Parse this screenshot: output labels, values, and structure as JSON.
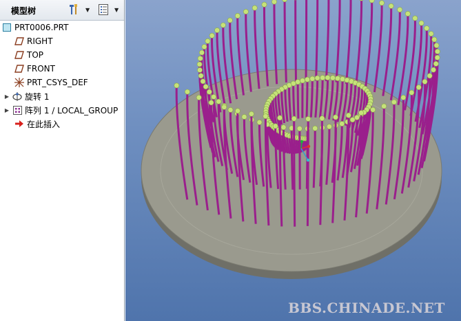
{
  "sidebar": {
    "title": "模型树",
    "tools": [
      {
        "icon": "model-tree-tools-icon"
      },
      {
        "icon": "tree-settings-icon"
      }
    ],
    "items": [
      {
        "label": "PRT0006.PRT",
        "icon": "part-icon",
        "expandable": false
      },
      {
        "label": "RIGHT",
        "icon": "datum-plane-icon",
        "expandable": false
      },
      {
        "label": "TOP",
        "icon": "datum-plane-icon",
        "expandable": false
      },
      {
        "label": "FRONT",
        "icon": "datum-plane-icon",
        "expandable": false
      },
      {
        "label": "PRT_CSYS_DEF",
        "icon": "coordinate-system-icon",
        "expandable": false
      },
      {
        "label": "旋转 1",
        "icon": "revolve-icon",
        "expandable": true
      },
      {
        "label": "阵列 1 / LOCAL_GROUP",
        "icon": "pattern-icon",
        "expandable": true
      },
      {
        "label": "在此插入",
        "icon": "insert-here-arrow-icon",
        "expandable": false
      }
    ]
  },
  "viewport": {
    "watermark": "BBS.CHINADE.NET",
    "colors": {
      "background_top": "#8aa3cc",
      "background_bottom": "#4f74ac",
      "disc": "#9a9a8e",
      "rod": "#9a1f8c",
      "ball": "#c6e27a"
    }
  }
}
